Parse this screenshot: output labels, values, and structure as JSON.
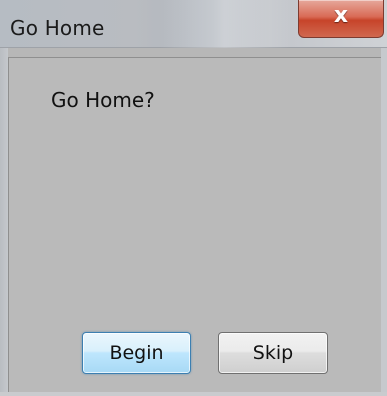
{
  "window": {
    "title": "Go Home",
    "close_icon": "close-icon",
    "close_glyph": "x"
  },
  "dialog": {
    "message": "Go Home?"
  },
  "buttons": {
    "begin_label": "Begin",
    "skip_label": "Skip"
  },
  "colors": {
    "close_button": "#d0503a",
    "default_button_border": "#3c7fb1",
    "client_background": "#bababa"
  }
}
